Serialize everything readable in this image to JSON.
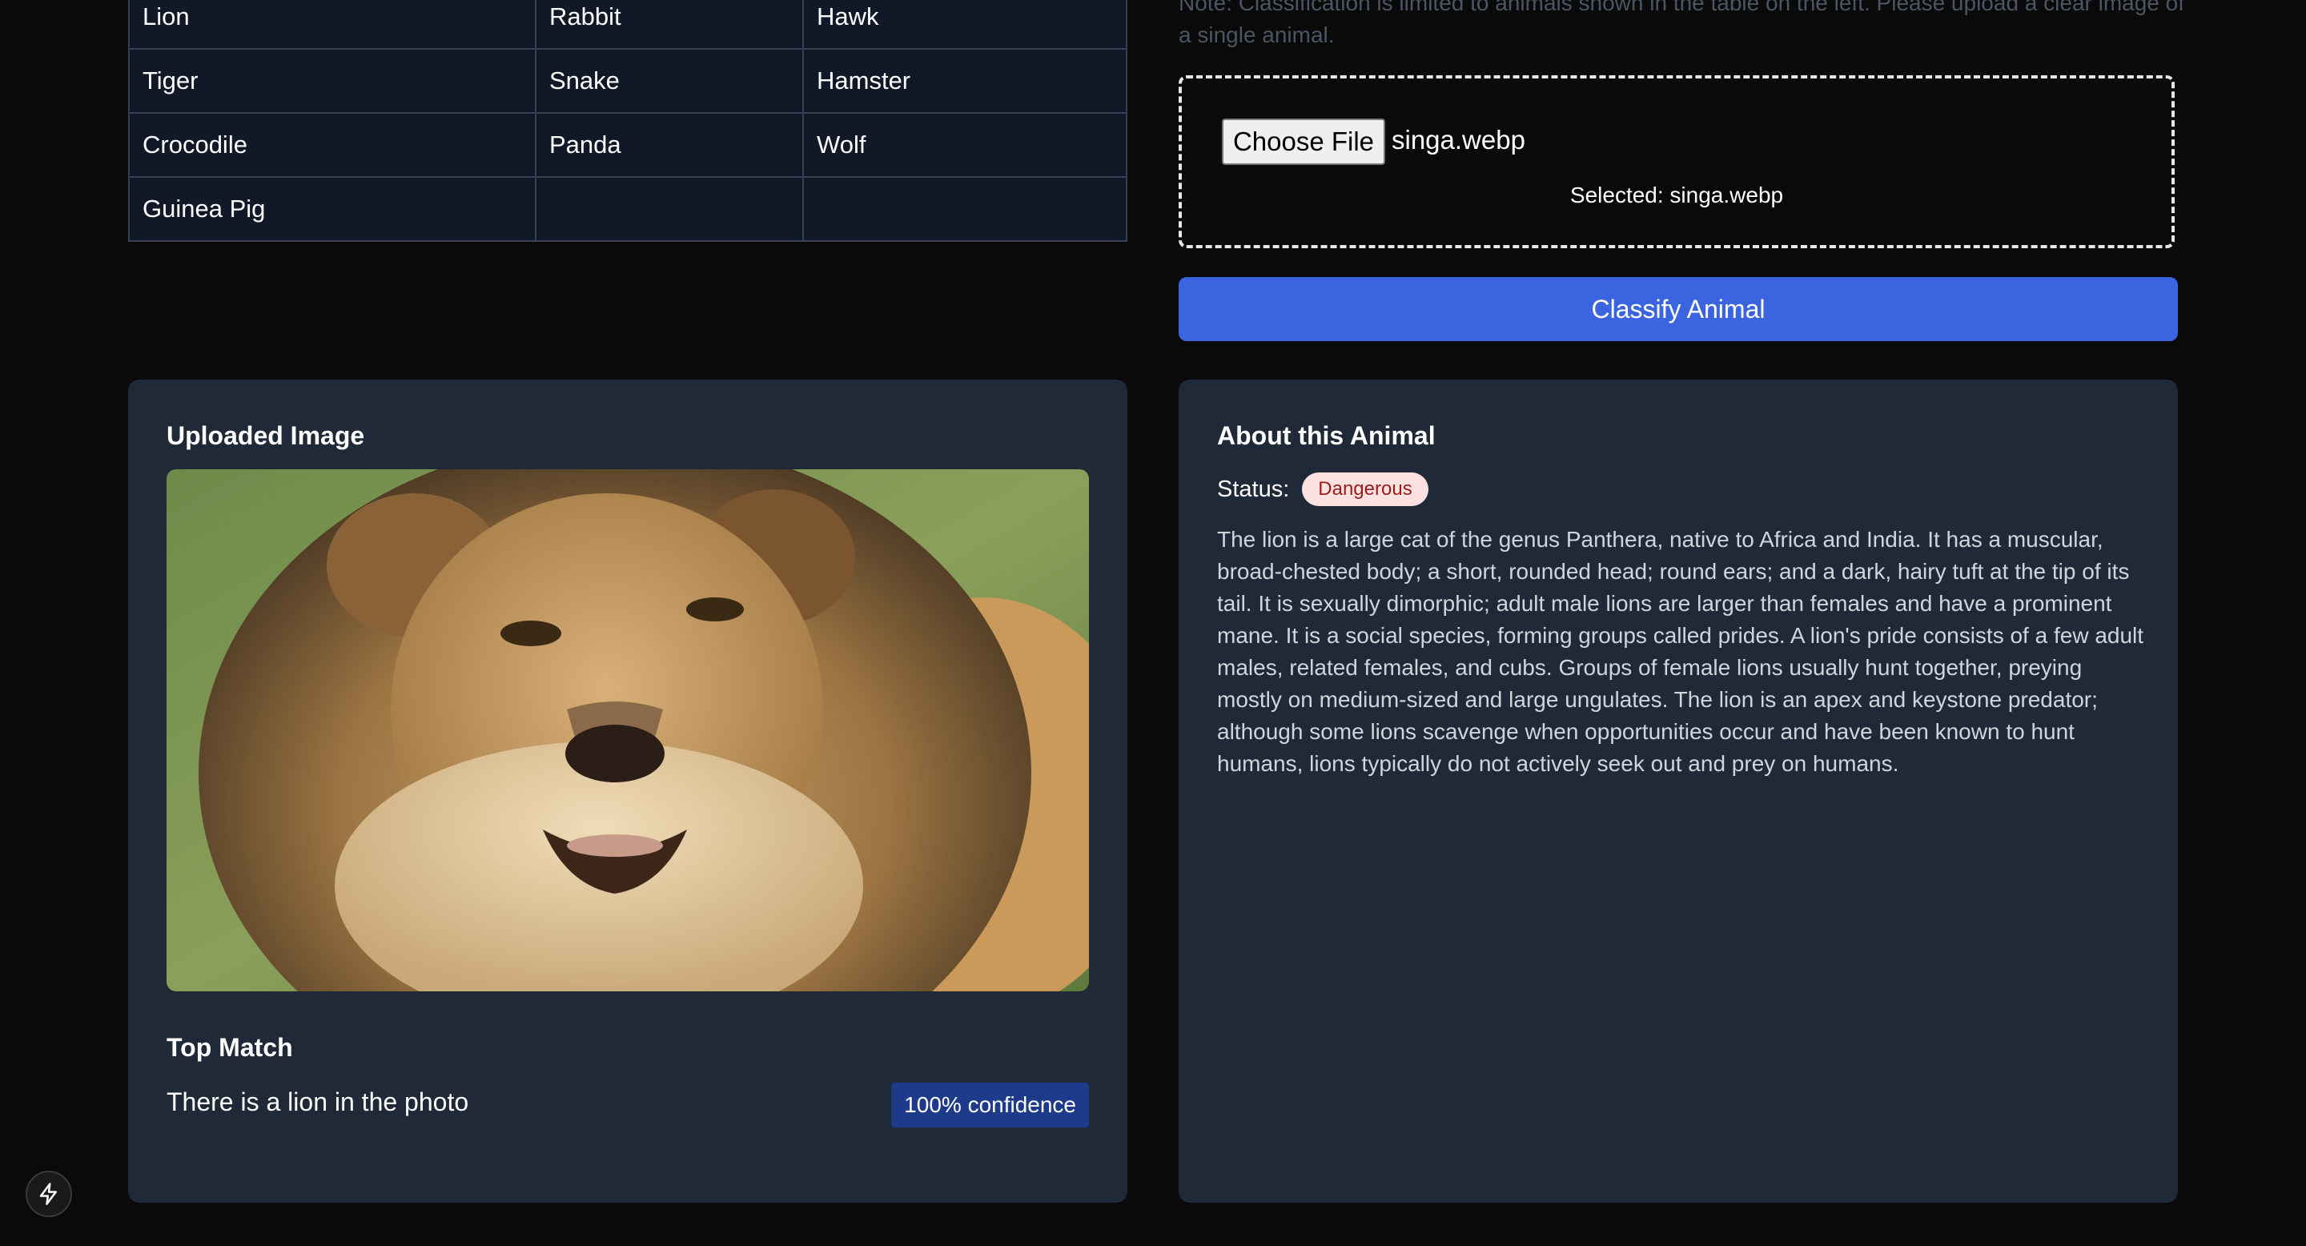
{
  "table": {
    "rows": [
      [
        "Lion",
        "Rabbit",
        "Hawk"
      ],
      [
        "Tiger",
        "Snake",
        "Hamster"
      ],
      [
        "Crocodile",
        "Panda",
        "Wolf"
      ],
      [
        "Guinea Pig",
        "",
        ""
      ]
    ]
  },
  "upload": {
    "note": "Note: Classification is limited to animals shown in the table on the left. Please upload a clear image of a single animal.",
    "choose_file_label": "Choose File",
    "file_name": "singa.webp",
    "selected_text": "Selected: singa.webp",
    "classify_label": "Classify Animal"
  },
  "result": {
    "uploaded_title": "Uploaded Image",
    "top_match_title": "Top Match",
    "match_text": "There is a lion in the photo",
    "confidence": "100% confidence"
  },
  "about": {
    "title": "About this Animal",
    "status_label": "Status:",
    "status_value": "Dangerous",
    "description": "The lion is a large cat of the genus Panthera, native to Africa and India. It has a muscular, broad-chested body; a short, rounded head; round ears; and a dark, hairy tuft at the tip of its tail. It is sexually dimorphic; adult male lions are larger than females and have a prominent mane. It is a social species, forming groups called prides. A lion's pride consists of a few adult males, related females, and cubs. Groups of female lions usually hunt together, preying mostly on medium-sized and large ungulates. The lion is an apex and keystone predator; although some lions scavenge when opportunities occur and have been known to hunt humans, lions typically do not actively seek out and prey on humans."
  },
  "colors": {
    "accent": "#3b65e0",
    "card": "#1f2937",
    "badge_danger_bg": "#fee2e2",
    "badge_danger_fg": "#991b1b"
  },
  "icons": {
    "dev_tool": "lightning-bolt-icon"
  }
}
